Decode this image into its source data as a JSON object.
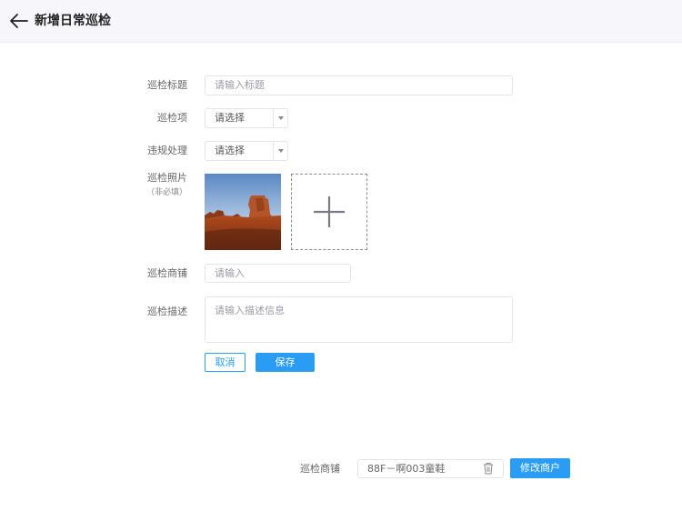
{
  "header": {
    "title": "新增日常巡检",
    "back_icon": "arrow-left-icon"
  },
  "form": {
    "title_label": "巡检标题",
    "title_placeholder": "请输入标题",
    "item_label": "巡检项",
    "item_value": "请选择",
    "violation_label": "违规处理",
    "violation_value": "请选择",
    "photo_label": "巡检照片",
    "photo_optional": "（非必填）",
    "shop_label": "巡检商铺",
    "shop_placeholder": "请输入",
    "desc_label": "巡检描述",
    "desc_placeholder": "请输入描述信息",
    "cancel_label": "取消",
    "save_label": "保存"
  },
  "bottom": {
    "shop_label": "巡检商铺",
    "shop_value": "88F－啊003童鞋",
    "modify_label": "修改商户"
  },
  "colors": {
    "accent": "#2a9cf3",
    "header_bg": "#f7f7fb"
  }
}
